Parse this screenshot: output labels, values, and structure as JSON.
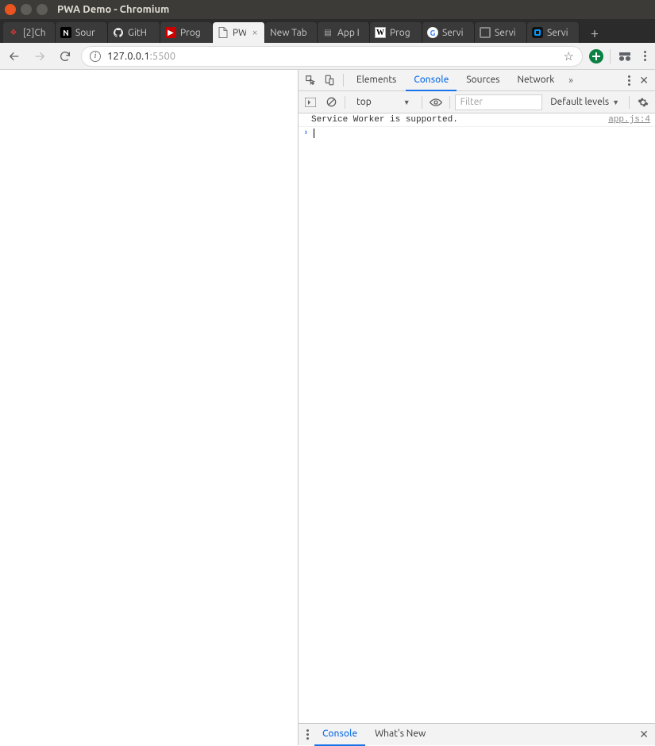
{
  "window": {
    "title": "PWA Demo - Chromium"
  },
  "tabs": [
    {
      "label": "[2]Ch"
    },
    {
      "label": "Sour"
    },
    {
      "label": "GitH"
    },
    {
      "label": "Prog"
    },
    {
      "label": "PW"
    },
    {
      "label": "New Tab"
    },
    {
      "label": "App I"
    },
    {
      "label": "Prog"
    },
    {
      "label": "Servi"
    },
    {
      "label": "Servi"
    },
    {
      "label": "Servi"
    }
  ],
  "toolbar": {
    "address_host": "127.0.0.1",
    "address_port": ":5500"
  },
  "devtools": {
    "tabs": {
      "elements": "Elements",
      "console": "Console",
      "sources": "Sources",
      "network": "Network"
    },
    "console_bar": {
      "context": "top",
      "filter_placeholder": "Filter",
      "levels": "Default levels"
    },
    "log": {
      "message": "Service Worker is supported.",
      "source": "app.js:4"
    },
    "drawer": {
      "console": "Console",
      "whatsnew": "What's New"
    }
  }
}
